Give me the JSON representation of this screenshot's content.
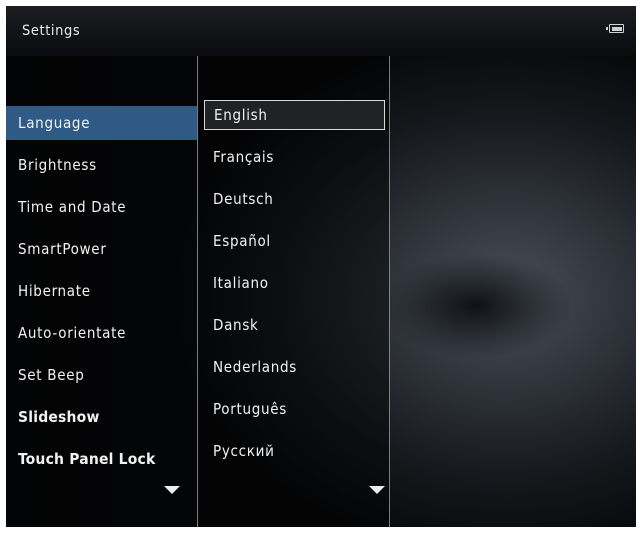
{
  "header": {
    "title": "Settings",
    "battery_icon": "battery-icon"
  },
  "settings_menu": {
    "items": [
      {
        "label": "Language",
        "selected": true
      },
      {
        "label": "Brightness"
      },
      {
        "label": "Time and Date"
      },
      {
        "label": "SmartPower"
      },
      {
        "label": "Hibernate"
      },
      {
        "label": "Auto-orientate"
      },
      {
        "label": "Set Beep"
      },
      {
        "label": "Slideshow"
      },
      {
        "label": "Touch Panel Lock"
      }
    ],
    "scroll_icon": "chevron-down-icon"
  },
  "language_menu": {
    "items": [
      {
        "label": "English",
        "focused": true
      },
      {
        "label": "Français"
      },
      {
        "label": "Deutsch"
      },
      {
        "label": "Español"
      },
      {
        "label": "Italiano"
      },
      {
        "label": "Dansk"
      },
      {
        "label": "Nederlands"
      },
      {
        "label": "Português"
      },
      {
        "label": "Русский"
      }
    ],
    "scroll_icon": "chevron-down-icon"
  },
  "colors": {
    "selection": "#2f5a86",
    "focus_border": "#d8d8d8",
    "text": "#f2f2f2"
  }
}
